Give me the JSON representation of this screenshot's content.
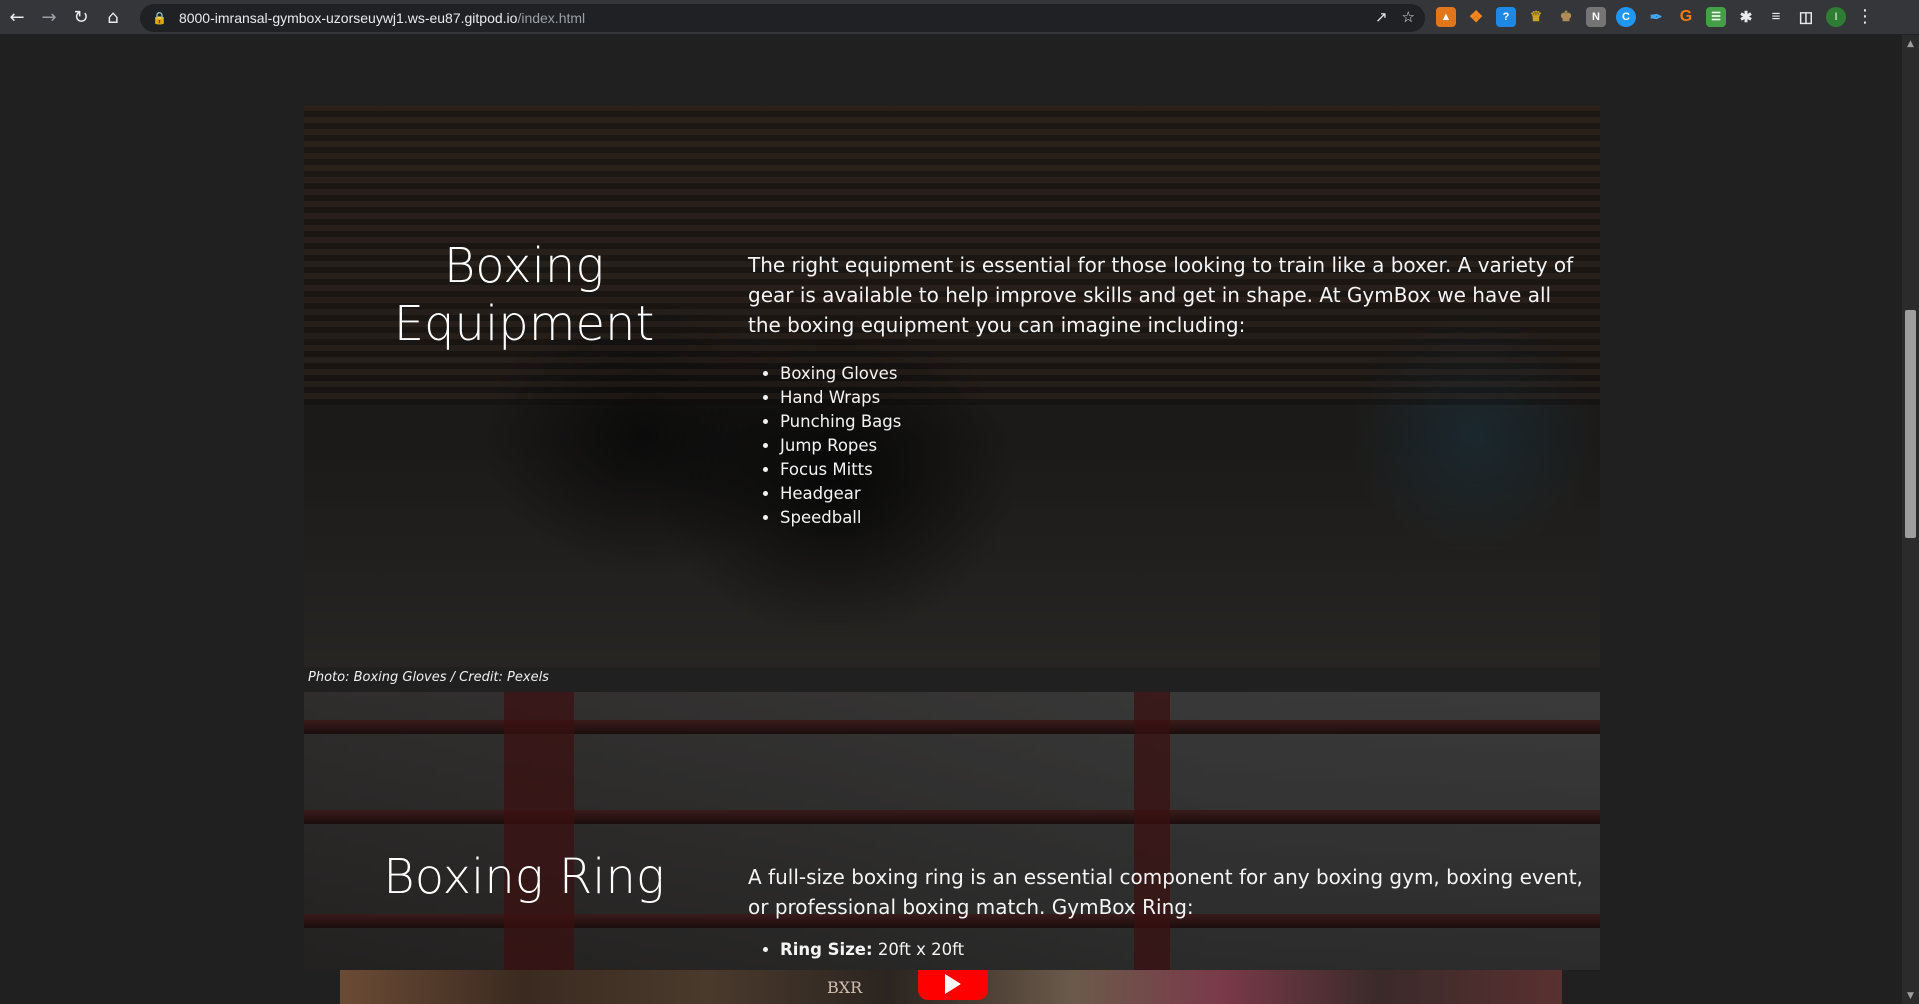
{
  "browser": {
    "url_host": "8000-imransal-gymbox-uzorseuywj1.ws-eu87.gitpod.io",
    "url_path": "/index.html",
    "profile_initial": "I",
    "nav_icons": [
      "back-arrow-icon",
      "forward-arrow-icon",
      "reload-icon",
      "home-icon"
    ],
    "omnibox_icons": [
      "share-icon",
      "bookmark-star-icon"
    ]
  },
  "equipment": {
    "title": "Boxing Equipment",
    "intro": "The right equipment is essential for those looking to train like a boxer. A variety of gear is available to help improve skills and get in shape. At GymBox we have all the boxing equipment you can imagine including:",
    "items": [
      "Boxing Gloves",
      "Hand Wraps",
      "Punching Bags",
      "Jump Ropes",
      "Focus Mitts",
      "Headgear",
      "Speedball"
    ],
    "caption": "Photo: Boxing Gloves / Credit: Pexels"
  },
  "ring": {
    "title": "Boxing Ring",
    "intro": "A full-size boxing ring is an essential component for any boxing gym, boxing event, or professional boxing match. GymBox Ring:",
    "first_item_label": "Ring Size:",
    "first_item_value": " 20ft x 20ft"
  },
  "video": {
    "sign_text": "BXR"
  },
  "colors": {
    "page_bg": "#202020",
    "chrome_bg": "#35363a",
    "youtube_red": "#ff0000"
  }
}
